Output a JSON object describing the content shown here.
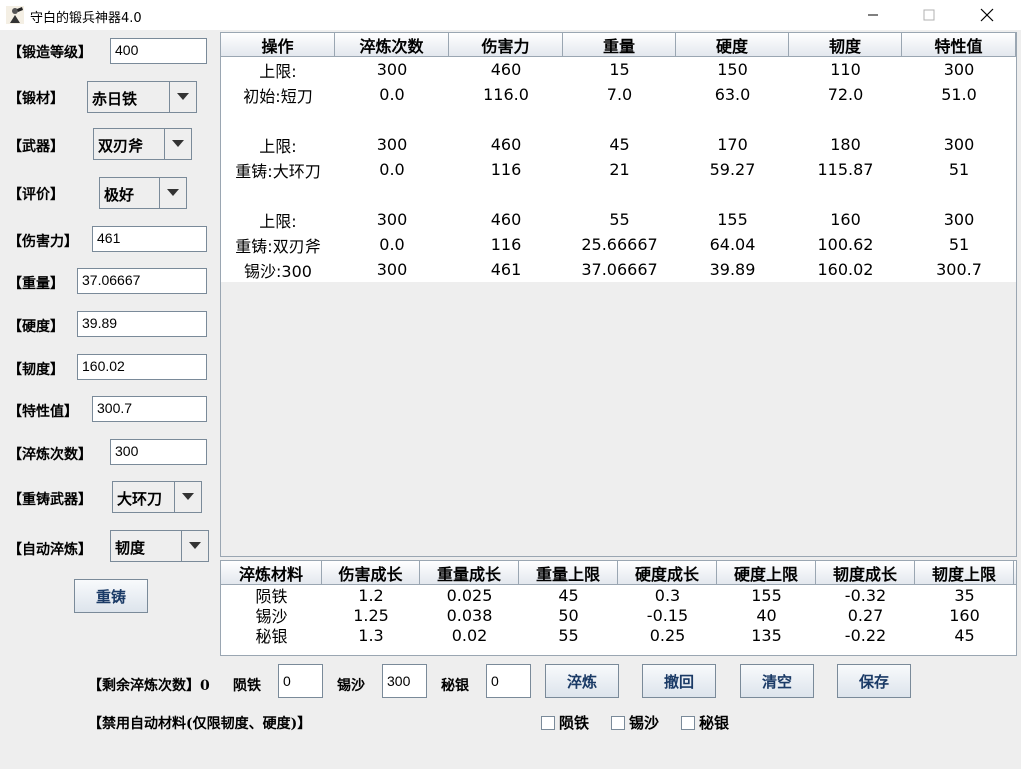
{
  "window": {
    "title": "守白的锻兵神器4.0",
    "app_icon": "hammer-person-icon",
    "minimize_icon": "minimize-icon",
    "maximize_icon": "maximize-icon",
    "close_icon": "close-icon"
  },
  "form": {
    "forge_level": {
      "label": "【锻造等级】",
      "value": "400"
    },
    "material": {
      "label": "【锻材】",
      "value": "赤日铁"
    },
    "weapon": {
      "label": "【武器】",
      "value": "双刃斧"
    },
    "rating": {
      "label": "【评价】",
      "value": "极好"
    },
    "damage": {
      "label": "【伤害力】",
      "value": "461"
    },
    "weight": {
      "label": "【重量】",
      "value": "37.06667"
    },
    "hardness": {
      "label": "【硬度】",
      "value": "39.89"
    },
    "toughness": {
      "label": "【韧度】",
      "value": "160.02"
    },
    "trait": {
      "label": "【特性值】",
      "value": "300.7"
    },
    "temper_count": {
      "label": "【淬炼次数】",
      "value": "300"
    },
    "recast_weapon": {
      "label": "【重铸武器】",
      "value": "大环刀"
    },
    "auto_temper": {
      "label": "【自动淬炼】",
      "value": "韧度"
    },
    "recast_button": "重铸"
  },
  "main_table": {
    "headers": [
      "操作",
      "淬炼次数",
      "伤害力",
      "重量",
      "硬度",
      "韧度",
      "特性值"
    ],
    "rows": [
      [
        "上限:",
        "300",
        "460",
        "15",
        "150",
        "110",
        "300"
      ],
      [
        "初始:短刀",
        "0.0",
        "116.0",
        "7.0",
        "63.0",
        "72.0",
        "51.0"
      ],
      [
        "",
        "",
        "",
        "",
        "",
        "",
        ""
      ],
      [
        "上限:",
        "300",
        "460",
        "45",
        "170",
        "180",
        "300"
      ],
      [
        "重铸:大环刀",
        "0.0",
        "116",
        "21",
        "59.27",
        "115.87",
        "51"
      ],
      [
        "",
        "",
        "",
        "",
        "",
        "",
        ""
      ],
      [
        "上限:",
        "300",
        "460",
        "55",
        "155",
        "160",
        "300"
      ],
      [
        "重铸:双刃斧",
        "0.0",
        "116",
        "25.66667",
        "64.04",
        "100.62",
        "51"
      ],
      [
        "锡沙:300",
        "300",
        "461",
        "37.06667",
        "39.89",
        "160.02",
        "300.7"
      ]
    ]
  },
  "material_table": {
    "headers": [
      "淬炼材料",
      "伤害成长",
      "重量成长",
      "重量上限",
      "硬度成长",
      "硬度上限",
      "韧度成长",
      "韧度上限"
    ],
    "rows": [
      [
        "陨铁",
        "1.2",
        "0.025",
        "45",
        "0.3",
        "155",
        "-0.32",
        "35"
      ],
      [
        "锡沙",
        "1.25",
        "0.038",
        "50",
        "-0.15",
        "40",
        "0.27",
        "160"
      ],
      [
        "秘银",
        "1.3",
        "0.02",
        "55",
        "0.25",
        "135",
        "-0.22",
        "45"
      ]
    ]
  },
  "bottom": {
    "remaining_label": "【剩余淬炼次数】0",
    "meteor_label": "陨铁",
    "meteor_value": "0",
    "tinsand_label": "锡沙",
    "tinsand_value": "300",
    "mithril_label": "秘银",
    "mithril_value": "0",
    "temper_button": "淬炼",
    "undo_button": "撤回",
    "clear_button": "清空",
    "save_button": "保存",
    "disable_auto_label": "【禁用自动材料(仅限韧度、硬度)】",
    "cb_meteor": "陨铁",
    "cb_tinsand": "锡沙",
    "cb_mithril": "秘银"
  }
}
